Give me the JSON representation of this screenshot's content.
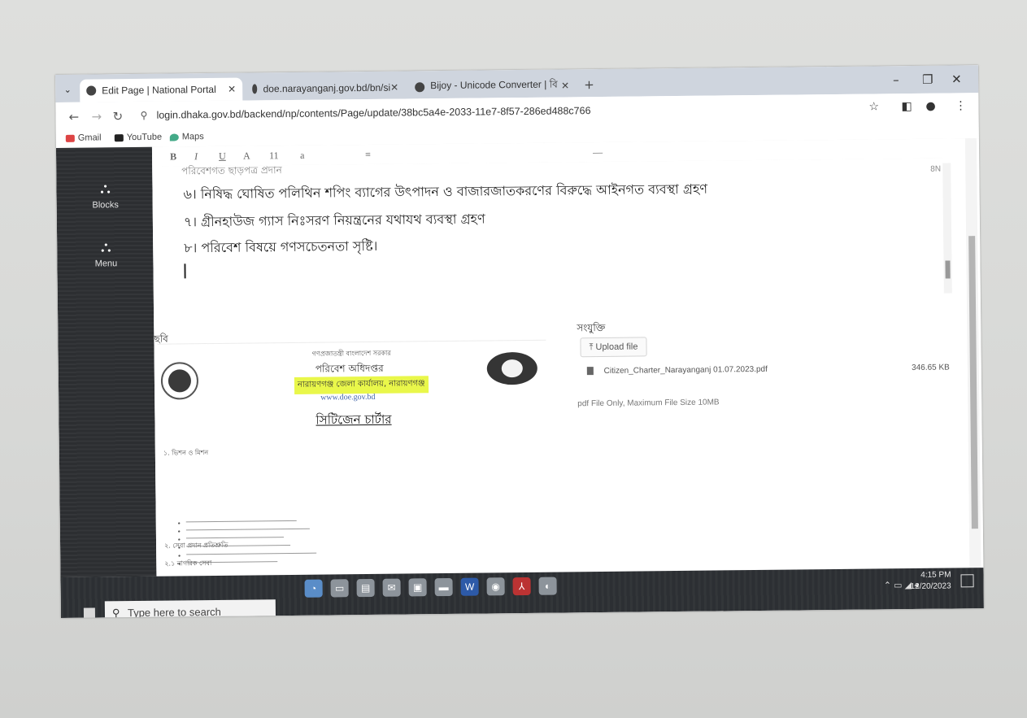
{
  "browser": {
    "tabs": [
      {
        "title": "Edit Page | National Portal"
      },
      {
        "title": "doe.narayanganj.gov.bd/bn/si"
      },
      {
        "title": "Bijoy - Unicode Converter | বি"
      }
    ],
    "url": "login.dhaka.gov.bd/backend/np/contents/Page/update/38bc5a4e-2033-11e7-8f57-286ed488c766",
    "bookmarks": [
      {
        "label": "Gmail"
      },
      {
        "label": "YouTube"
      },
      {
        "label": "Maps"
      }
    ]
  },
  "sidebar": {
    "items": [
      {
        "label": "Blocks"
      },
      {
        "label": "Menu"
      }
    ]
  },
  "editor": {
    "toolbar_labels": [
      "B",
      "I",
      "U",
      "A",
      "11",
      "a",
      "≡",
      "—"
    ],
    "partial_line": "পরিবেশগত ছাড়পত্র প্রদান",
    "lines": [
      "৬। নিষিদ্ধ ঘোষিত পলিথিন শপিং ব্যাগের উৎপাদন ও বাজারজাতকরণের বিরুদ্ধে আইনগত ব্যবস্থা গ্রহণ",
      "৭। গ্রীনহাউজ গ্যাস নিঃসরণ  নিয়ন্ত্রনের যথাযথ ব্যবস্থা গ্রহণ",
      "৮। পরিবেশ বিষয়ে গণসচেতনতা সৃষ্টি।"
    ],
    "word_count": "8N"
  },
  "image_section": {
    "label": "ছবি",
    "doc": {
      "header": "গণপ্রজাতন্ত্রী বাংলাদেশ সরকার",
      "dept": "পরিবেশ অধিদপ্তর",
      "office": "নারায়ণগঞ্জ জেলা কার্যালয়, নারায়ণগঞ্জ",
      "website": "www.doe.gov.bd",
      "title": "সিটিজেন চার্টার",
      "section1": "১. ভিশন ও মিশন",
      "section2": "২. সেবা প্রদান প্রতিশ্রুতি",
      "section3": "২.১ নাগরিক সেবা"
    }
  },
  "attachments": {
    "label": "সংযুক্তি",
    "upload_label": "Upload file",
    "file_name": "Citizen_Charter_Narayanganj 01.07.2023.pdf",
    "file_size": "346.65 KB",
    "hint": "pdf File Only, Maximum File Size 10MB"
  },
  "taskbar": {
    "search_placeholder": "Type here to search",
    "time": "4:15 PM",
    "date": "12/20/2023"
  }
}
